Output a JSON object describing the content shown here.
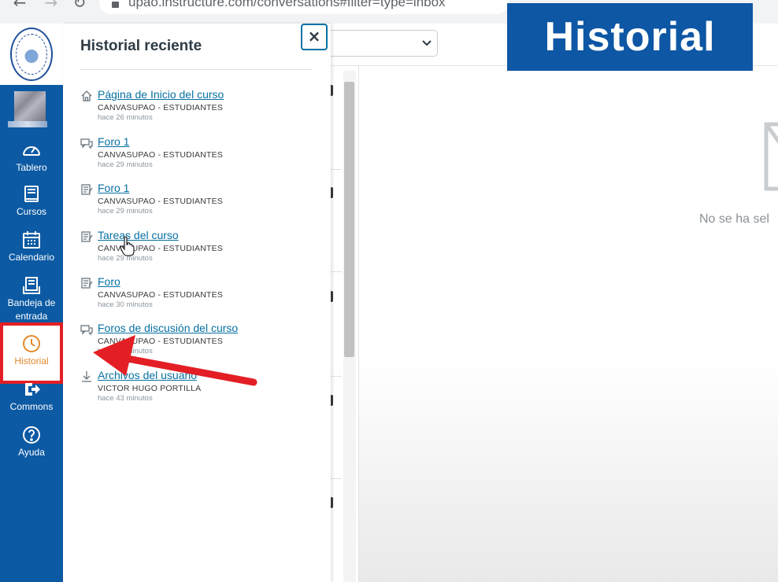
{
  "browser": {
    "url": "upao.instructure.com/conversations#filter=type=inbox",
    "back_glyph": "←",
    "forward_glyph": "→",
    "reload_glyph": "↻"
  },
  "global_nav": {
    "items": [
      {
        "label": "Tablero",
        "icon": "dashboard-gauge-icon"
      },
      {
        "label": "Cursos",
        "icon": "courses-book-icon"
      },
      {
        "label": "Calendario",
        "icon": "calendar-icon"
      },
      {
        "label": "Bandeja de entrada",
        "icon": "inbox-icon"
      },
      {
        "label": "Historial",
        "icon": "clock-icon",
        "active": true
      },
      {
        "label": "Commons",
        "icon": "commons-arrow-icon"
      },
      {
        "label": "Ayuda",
        "icon": "help-icon"
      }
    ]
  },
  "tray": {
    "title": "Historial reciente",
    "close_glyph": "×",
    "items": [
      {
        "title": "Página de Inicio del curso",
        "course": "CANVASUPAO - ESTUDIANTES",
        "time": "hace 26 minutos",
        "icon": "home-icon"
      },
      {
        "title": "Foro 1",
        "course": "CANVASUPAO - ESTUDIANTES",
        "time": "hace 29 minutos",
        "icon": "discussion-icon"
      },
      {
        "title": "Foro 1",
        "course": "CANVASUPAO - ESTUDIANTES",
        "time": "hace 29 minutos",
        "icon": "assignment-icon"
      },
      {
        "title": "Tareas del curso",
        "course": "CANVASUPAO - ESTUDIANTES",
        "time": "hace 29 minutos",
        "icon": "assignment-icon"
      },
      {
        "title": "Foro",
        "course": "CANVASUPAO - ESTUDIANTES",
        "time": "hace 30 minutos",
        "icon": "assignment-icon"
      },
      {
        "title": "Foros de discusión del curso",
        "course": "CANVASUPAO - ESTUDIANTES",
        "time": "hace 30 minutos",
        "icon": "discussion-icon"
      },
      {
        "title": "Archivos del usuario",
        "course": "VICTOR HUGO PORTILLA",
        "time": "hace 43 minutos",
        "icon": "download-icon"
      }
    ]
  },
  "inbox": {
    "empty_text": "No se ha sel"
  },
  "banner": {
    "text": "Historial"
  },
  "colors": {
    "nav_bg": "#0c5aa3",
    "link": "#0770a3",
    "active_text": "#e28a2b",
    "highlight_red": "#e31f25",
    "banner_bg": "#0d57a4"
  }
}
